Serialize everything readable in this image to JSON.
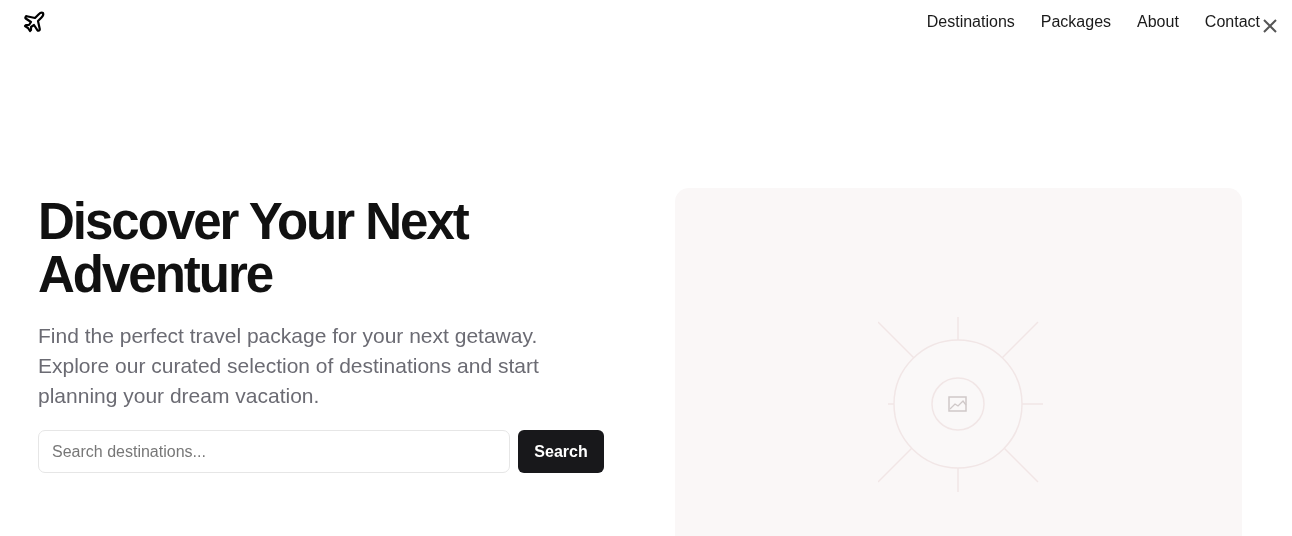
{
  "nav": {
    "links": [
      {
        "label": "Destinations"
      },
      {
        "label": "Packages"
      },
      {
        "label": "About"
      },
      {
        "label": "Contact"
      }
    ]
  },
  "hero": {
    "title": "Discover Your Next Adventure",
    "text": "Find the perfect travel package for your next getaway. Explore our curated selection of destinations and start planning your dream vacation.",
    "search": {
      "placeholder": "Search destinations..."
    },
    "button": "Search"
  }
}
